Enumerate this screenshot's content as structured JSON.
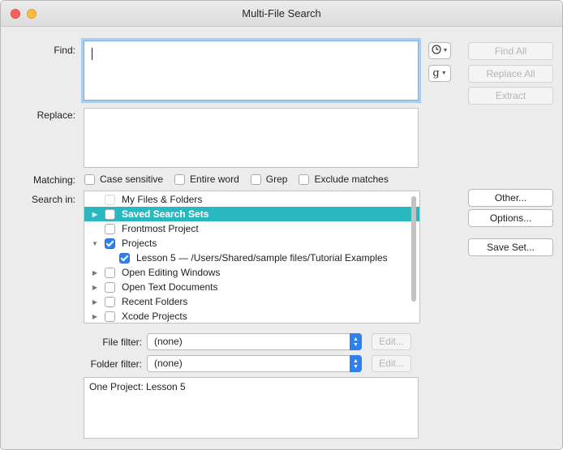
{
  "window": {
    "title": "Multi-File Search"
  },
  "labels": {
    "find": "Find:",
    "replace": "Replace:",
    "matching": "Matching:",
    "search_in": "Search in:",
    "file_filter": "File filter:",
    "folder_filter": "Folder filter:"
  },
  "find": {
    "value": ""
  },
  "replace": {
    "value": ""
  },
  "popups": {
    "history_icon": "clock-icon",
    "grep_label": "g"
  },
  "buttons": {
    "find_all": "Find All",
    "replace_all": "Replace All",
    "extract": "Extract",
    "other": "Other...",
    "options": "Options...",
    "save_set": "Save Set...",
    "file_edit": "Edit...",
    "folder_edit": "Edit..."
  },
  "matching": [
    {
      "label": "Case sensitive",
      "checked": false
    },
    {
      "label": "Entire word",
      "checked": false
    },
    {
      "label": "Grep",
      "checked": false
    },
    {
      "label": "Exclude matches",
      "checked": false
    }
  ],
  "search_sources": [
    {
      "label": "My Files & Folders",
      "disclosure": "",
      "checked": false,
      "selected": false,
      "indent": 0,
      "disabled": true
    },
    {
      "label": "Saved Search Sets",
      "disclosure": "▶",
      "checked": false,
      "selected": true,
      "indent": 0
    },
    {
      "label": "Frontmost Project",
      "disclosure": "",
      "checked": false,
      "selected": false,
      "indent": 0
    },
    {
      "label": "Projects",
      "disclosure": "▼",
      "checked": true,
      "selected": false,
      "indent": 0
    },
    {
      "label": "Lesson 5 — /Users/Shared/sample files/Tutorial Examples",
      "disclosure": "",
      "checked": true,
      "selected": false,
      "indent": 1
    },
    {
      "label": "Open Editing Windows",
      "disclosure": "▶",
      "checked": false,
      "selected": false,
      "indent": 0
    },
    {
      "label": "Open Text Documents",
      "disclosure": "▶",
      "checked": false,
      "selected": false,
      "indent": 0
    },
    {
      "label": "Recent Folders",
      "disclosure": "▶",
      "checked": false,
      "selected": false,
      "indent": 0
    },
    {
      "label": "Xcode Projects",
      "disclosure": "▶",
      "checked": false,
      "selected": false,
      "indent": 0
    }
  ],
  "file_filter": {
    "value": "(none)"
  },
  "folder_filter": {
    "value": "(none)"
  },
  "summary": "One Project: Lesson 5",
  "colors": {
    "selection": "#2ab8c0",
    "focus_ring": "#aacdf3",
    "accent": "#2f80ed"
  }
}
